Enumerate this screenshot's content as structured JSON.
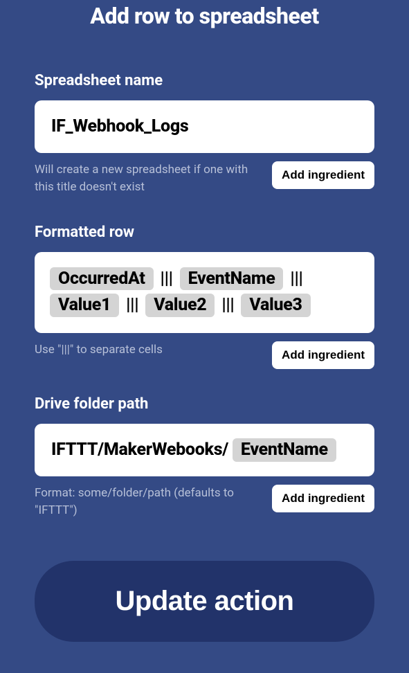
{
  "title": "Add row to spreadsheet",
  "fields": {
    "spreadsheet": {
      "label": "Spreadsheet name",
      "value": "IF_Webhook_Logs",
      "helper": "Will create a new spreadsheet if one with this title doesn't exist",
      "addBtn": "Add ingredient"
    },
    "row": {
      "label": "Formatted row",
      "ingredients": [
        "OccurredAt",
        "EventName",
        "Value1",
        "Value2",
        "Value3"
      ],
      "separator": "|||",
      "helper": "Use \"|||\" to separate cells",
      "addBtn": "Add ingredient"
    },
    "path": {
      "label": "Drive folder path",
      "prefix": "IFTTT/MakerWebooks/",
      "ingredient": "EventName",
      "helper": "Format: some/folder/path (defaults to \"IFTTT\")",
      "addBtn": "Add ingredient"
    }
  },
  "submit": "Update action"
}
